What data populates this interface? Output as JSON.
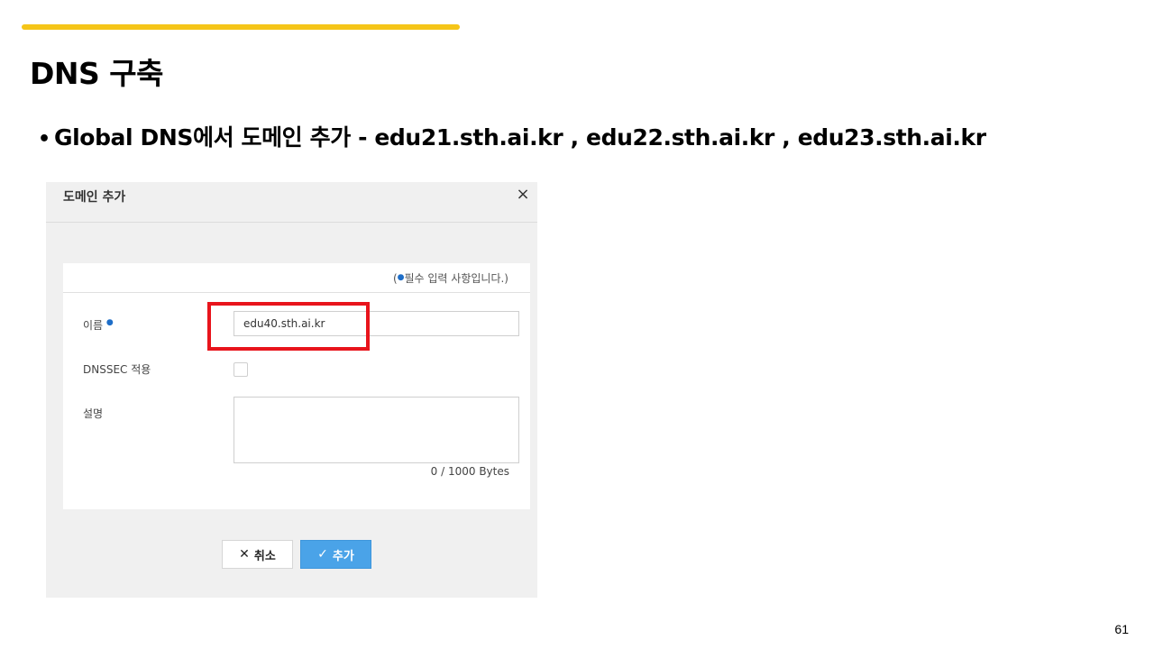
{
  "slide": {
    "title": "DNS 구축",
    "bullet_symbol": "•",
    "bullet_text": "Global DNS에서 도메인 추가  - edu21.sth.ai.kr  , edu22.sth.ai.kr , edu23.sth.ai.kr",
    "page_number": "61",
    "accent_color": "#f5c518"
  },
  "dialog": {
    "title": "도메인 추가",
    "close_icon": "×",
    "required_note_prefix": "(",
    "required_dot": "●",
    "required_note_text": "필수 입력 사항입니다.)",
    "fields": {
      "name_label": "이름",
      "name_value": "edu40.sth.ai.kr",
      "dnssec_label": "DNSSEC 적용",
      "description_label": "설명",
      "byte_counter": "0 / 1000 Bytes"
    },
    "buttons": {
      "cancel_icon": "✕",
      "cancel_label": "취소",
      "add_icon": "✓",
      "add_label": "추가"
    },
    "highlight_color": "#e8141c",
    "primary_color": "#4aa3e8"
  }
}
